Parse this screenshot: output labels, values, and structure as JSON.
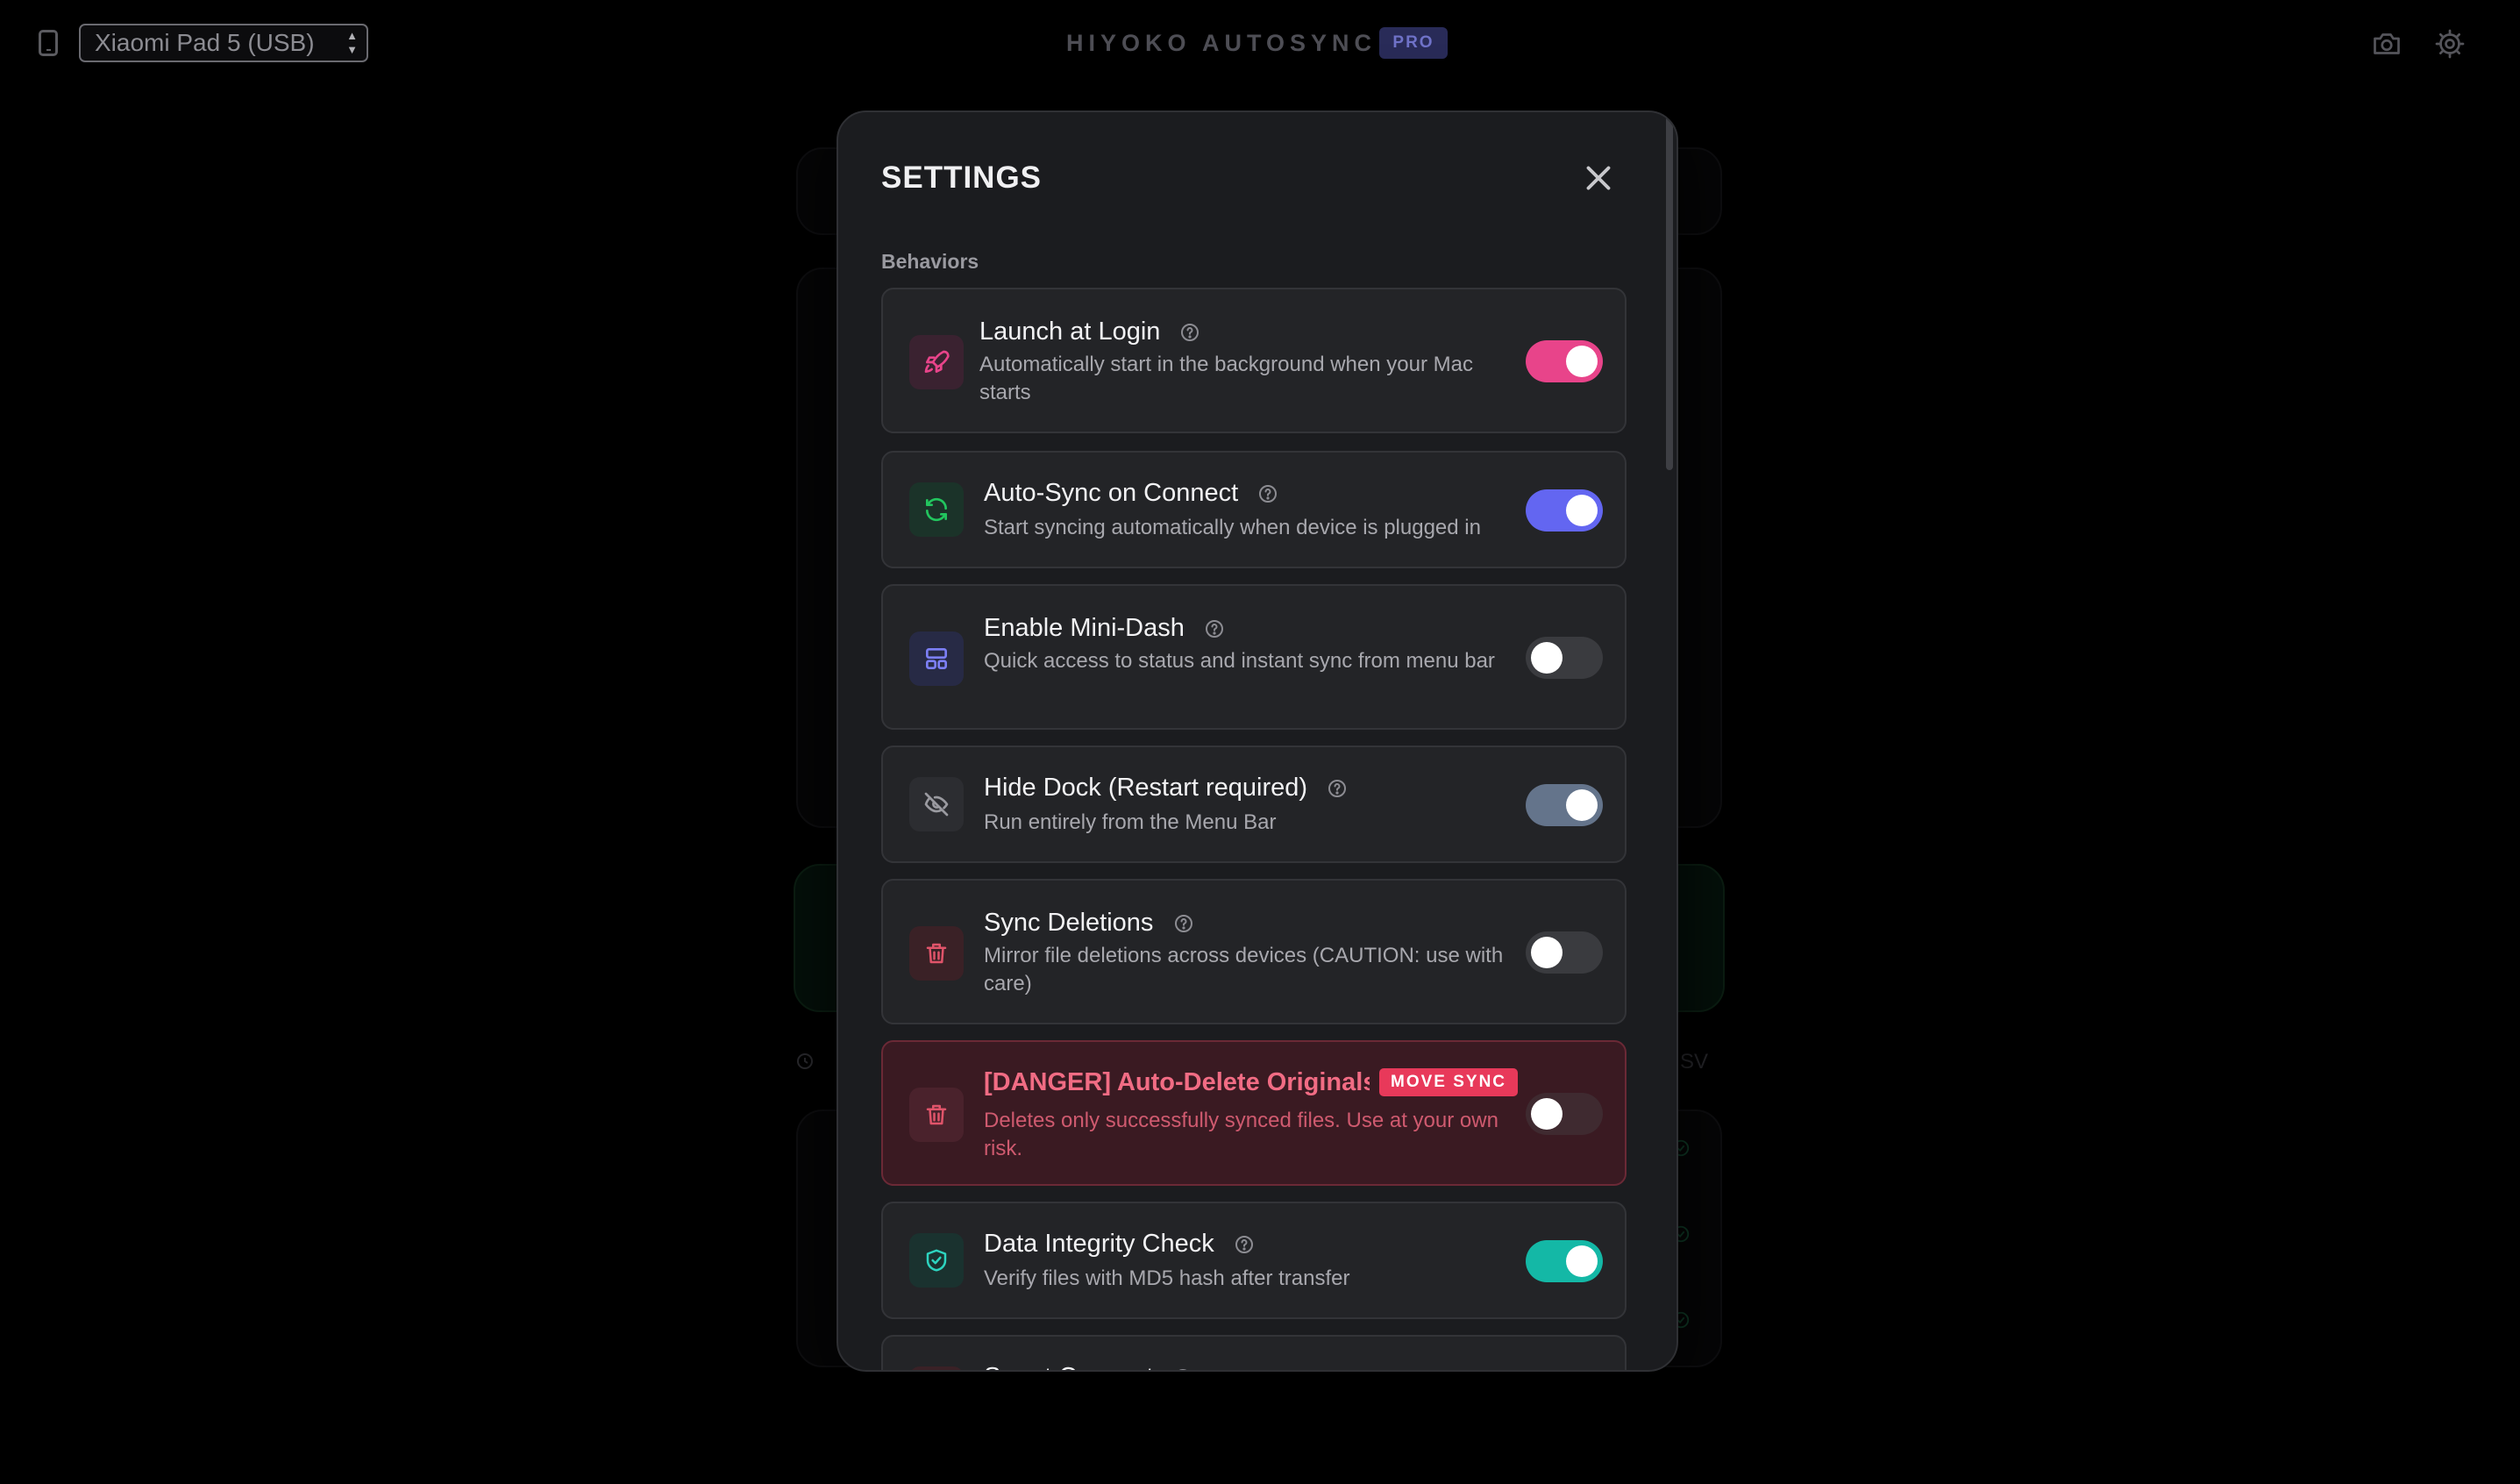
{
  "topbar": {
    "device_selected": "Xiaomi Pad 5 (USB)",
    "app_title": "HIYOKO AUTOSYNC",
    "pro_badge": "PRO"
  },
  "background": {
    "partial_label": "SV"
  },
  "settings": {
    "title": "SETTINGS",
    "section_label": "Behaviors",
    "items": [
      {
        "title": "Launch at Login",
        "desc": "Automatically start in the background when your Mac starts",
        "on": true,
        "color": "#e8448a",
        "icon": "rocket-icon"
      },
      {
        "title": "Auto-Sync on Connect",
        "desc": "Start syncing automatically when device is plugged in",
        "on": true,
        "color": "#6366f1",
        "icon": "refresh-icon"
      },
      {
        "title": "Enable Mini-Dash",
        "desc": "Quick access to status and instant sync from menu bar",
        "on": false,
        "icon": "layout-icon"
      },
      {
        "title": "Hide Dock (Restart required)",
        "desc": "Run entirely from the Menu Bar",
        "on": true,
        "color": "#64748b",
        "icon": "eye-off-icon"
      },
      {
        "title": "Sync Deletions",
        "desc": "Mirror file deletions across devices (CAUTION: use with care)",
        "on": false,
        "icon": "trash-icon"
      },
      {
        "title": "[DANGER] Auto-Delete Originals",
        "badge": "MOVE SYNC",
        "desc": "Deletes only successfully synced files. Use at your own risk.",
        "on": false,
        "icon": "trash-icon"
      },
      {
        "title": "Data Integrity Check",
        "desc": "Verify files with MD5 hash after transfer",
        "on": true,
        "color": "#14b8a6",
        "icon": "shield-check-icon"
      },
      {
        "title": "Smart Connect"
      }
    ]
  }
}
